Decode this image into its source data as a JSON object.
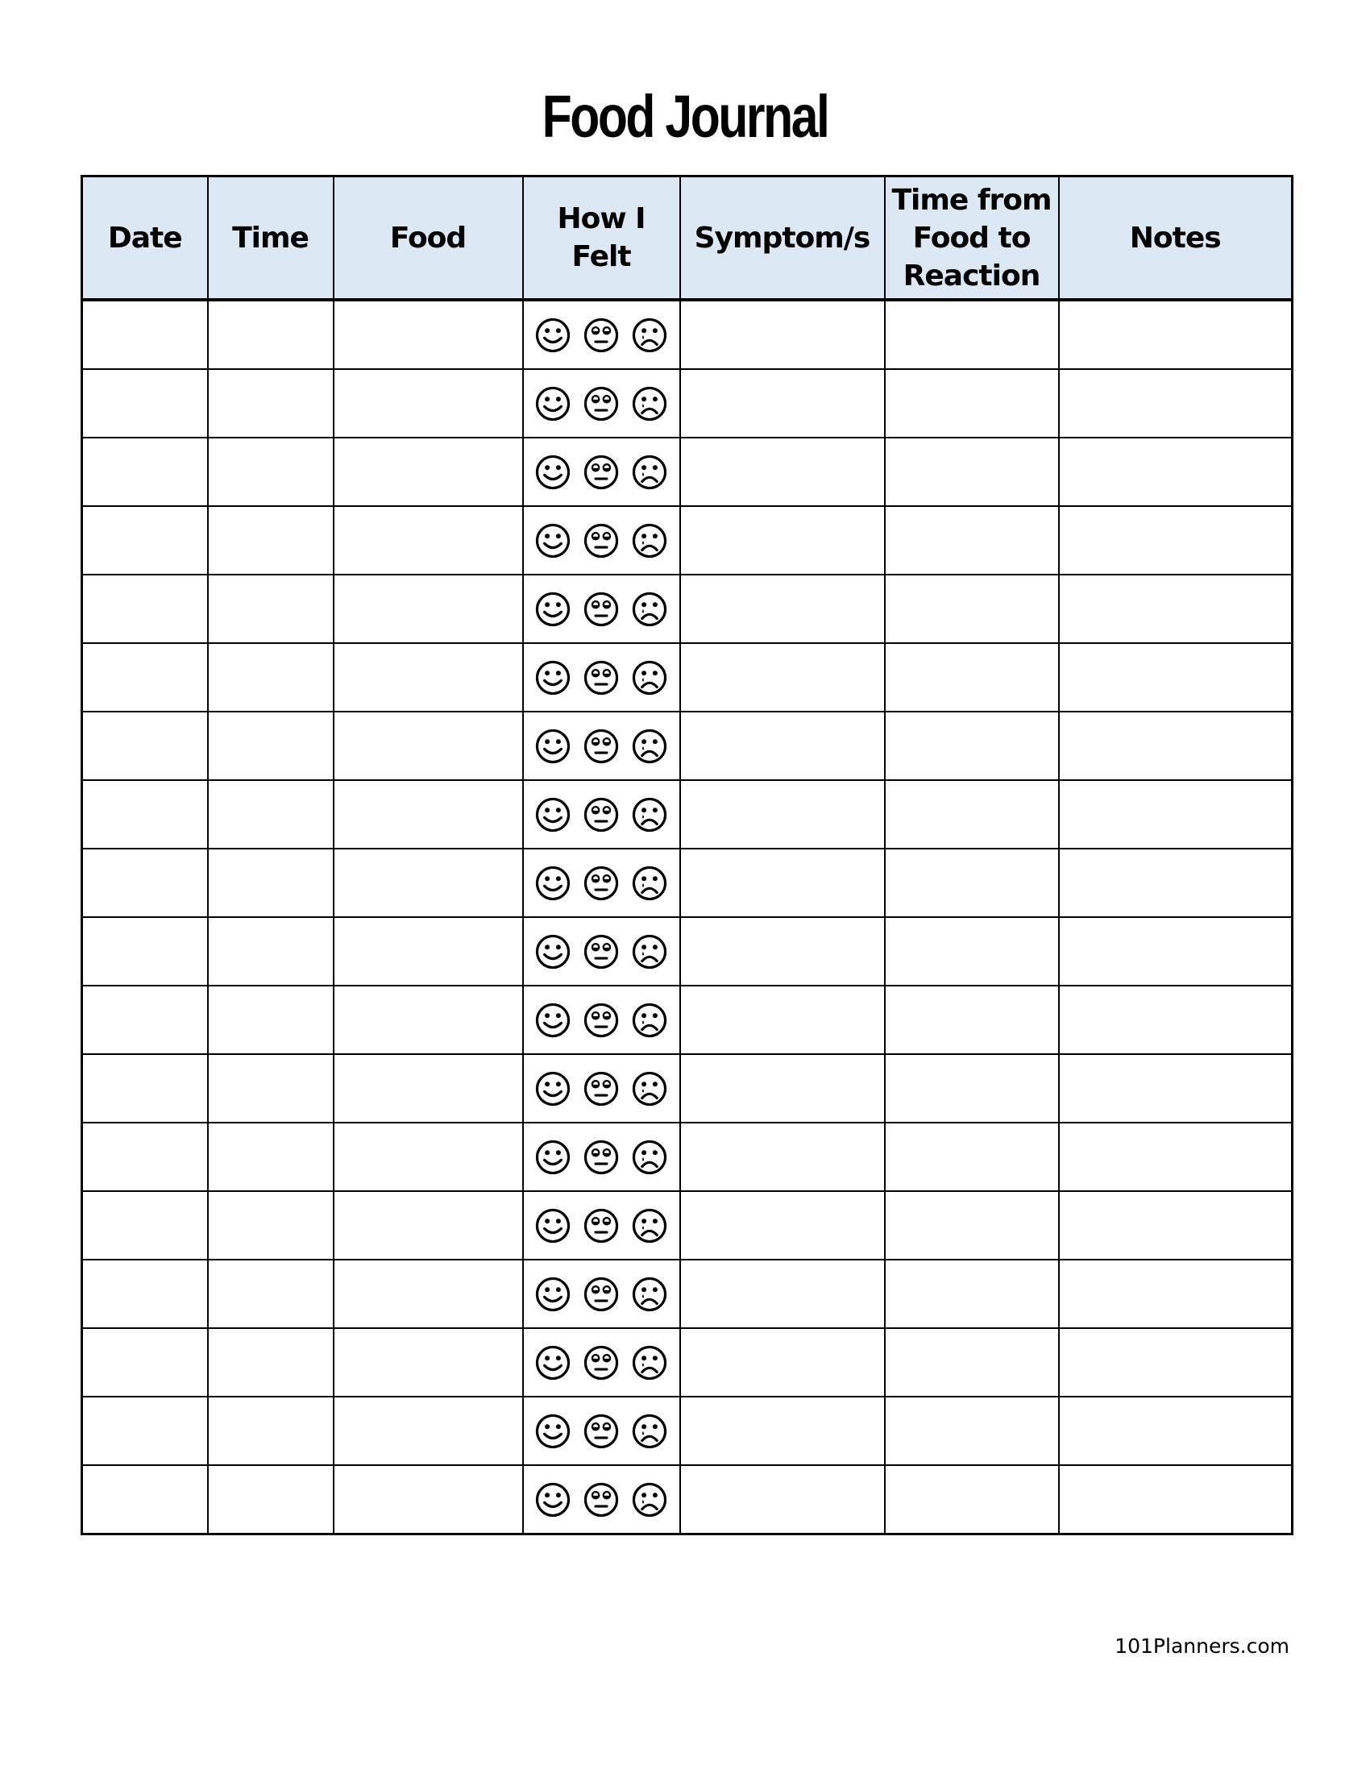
{
  "title": "Food Journal",
  "table": {
    "columns": [
      "Date",
      "Time",
      "Food",
      "How I Felt",
      "Symptom/s",
      "Time from Food to Reaction",
      "Notes"
    ],
    "header_lines": {
      "date": "Date",
      "time": "Time",
      "food": "Food",
      "felt_1": "How I",
      "felt_2": "Felt",
      "symptoms": "Symptom/s",
      "reaction_1": "Time from",
      "reaction_2": "Food to",
      "reaction_3": "Reaction",
      "notes": "Notes"
    },
    "row_count": 18,
    "feeling_options": [
      "happy-face",
      "neutral-face",
      "sad-face"
    ],
    "rows": []
  },
  "colors": {
    "header_background": "#dde8f5",
    "border": "#000000"
  },
  "footer": "101Planners.com"
}
